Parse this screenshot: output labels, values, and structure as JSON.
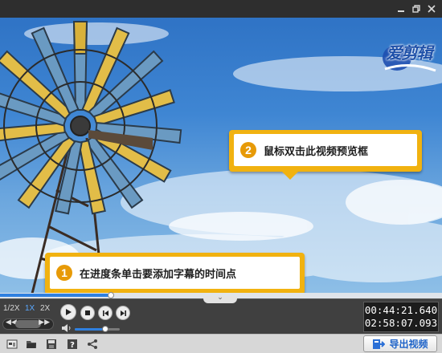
{
  "window": {
    "controls": [
      "minimize-icon",
      "restore-icon",
      "close-icon"
    ]
  },
  "logo": {
    "text": "爱剪辑"
  },
  "callouts": [
    {
      "number": "2",
      "text": "鼠标双击此视频预览框"
    },
    {
      "number": "1",
      "text": "在进度条单击要添加字幕的时间点"
    }
  ],
  "progress": {
    "position": 0.25
  },
  "speed": {
    "options": [
      "1/2X",
      "1X",
      "2X"
    ],
    "selected": "1X"
  },
  "playback": {
    "buttons": [
      "play-icon",
      "stop-icon",
      "previous-icon",
      "next-icon"
    ]
  },
  "volume": {
    "level": 0.68
  },
  "time": {
    "current": "00:44:21.640",
    "total": "02:58:07.093"
  },
  "toolbar": {
    "tools": [
      "new-project-icon",
      "open-folder-icon",
      "save-icon",
      "help-icon",
      "share-icon"
    ],
    "export_label": "导出视频"
  },
  "colors": {
    "accent": "#2f80e0",
    "callout": "#f1b210",
    "number_badge": "#e79a07"
  }
}
